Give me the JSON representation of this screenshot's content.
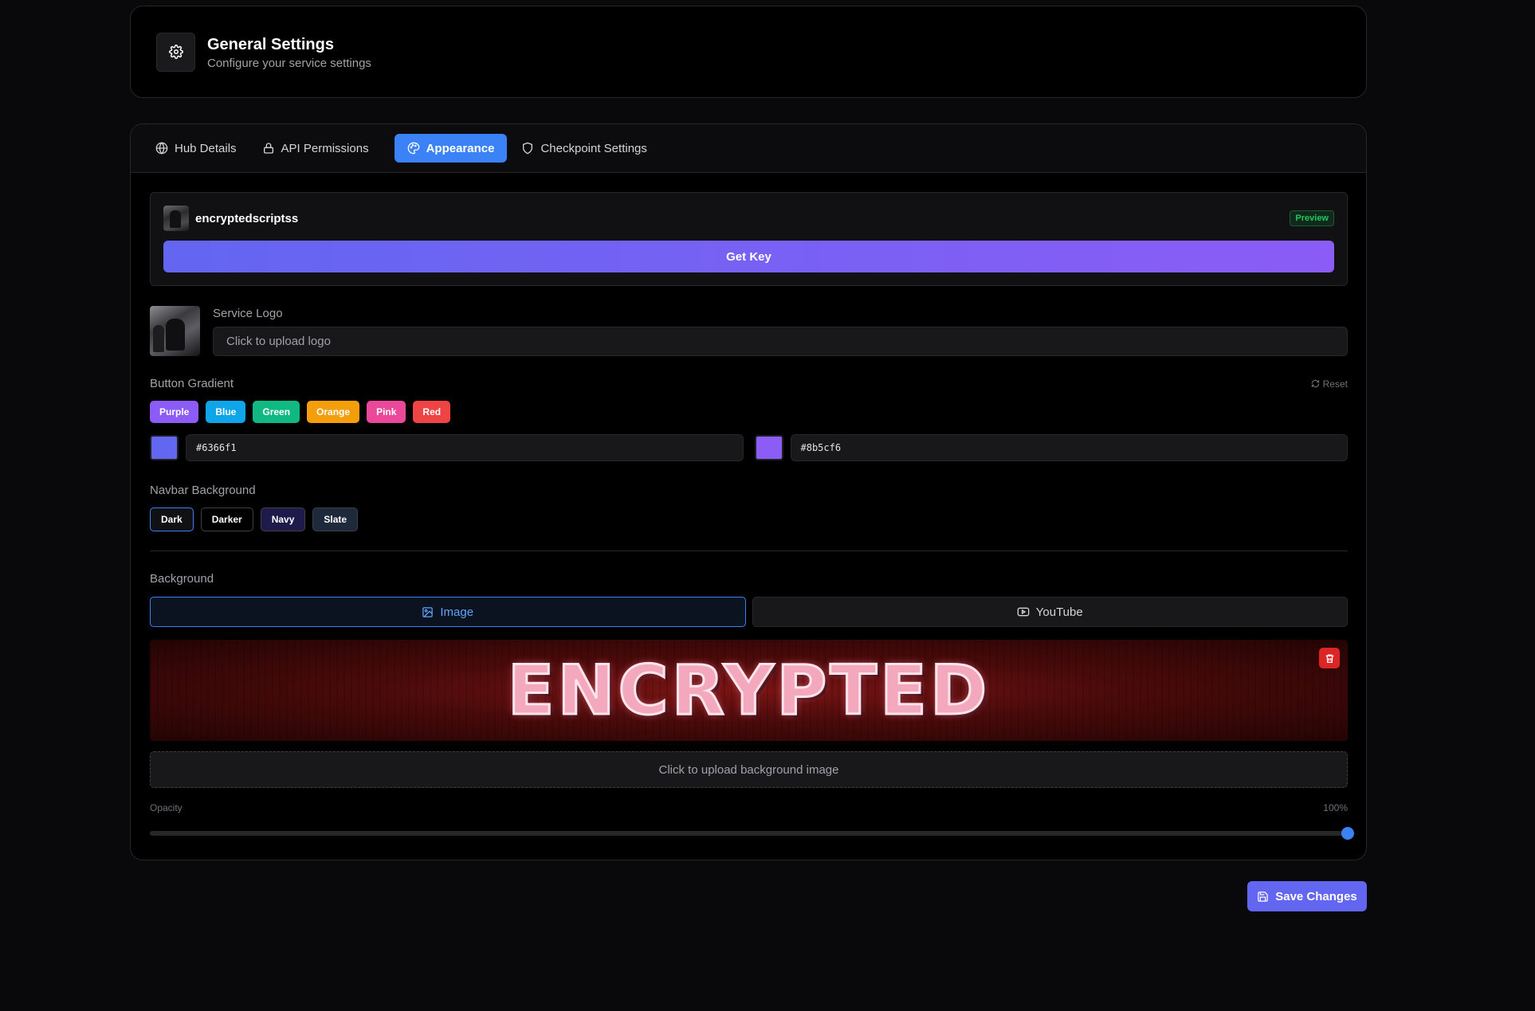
{
  "header": {
    "title": "General Settings",
    "subtitle": "Configure your service settings",
    "icon": "gear-icon"
  },
  "tabs": [
    {
      "label": "Hub Details",
      "icon": "globe-icon",
      "active": false
    },
    {
      "label": "API Permissions",
      "icon": "lock-icon",
      "active": false
    },
    {
      "label": "Appearance",
      "icon": "palette-icon",
      "active": true
    },
    {
      "label": "Checkpoint Settings",
      "icon": "shield-icon",
      "active": false
    }
  ],
  "preview": {
    "name": "encryptedscriptss",
    "badge": "Preview",
    "button_label": "Get Key"
  },
  "logo": {
    "label": "Service Logo",
    "upload_placeholder": "Click to upload logo"
  },
  "gradient": {
    "label": "Button Gradient",
    "reset_label": "Reset",
    "presets": [
      {
        "label": "Purple",
        "color": "#8b5cf6"
      },
      {
        "label": "Blue",
        "color": "#0ea5e9"
      },
      {
        "label": "Green",
        "color": "#10b981"
      },
      {
        "label": "Orange",
        "color": "#f59e0b"
      },
      {
        "label": "Pink",
        "color": "#ec4899"
      },
      {
        "label": "Red",
        "color": "#ef4444"
      }
    ],
    "color_start": "#6366f1",
    "color_end": "#8b5cf6"
  },
  "navbar": {
    "label": "Navbar Background",
    "options": [
      {
        "label": "Dark",
        "color": "#111113",
        "selected": true
      },
      {
        "label": "Darker",
        "color": "#000000",
        "selected": false
      },
      {
        "label": "Navy",
        "color": "#1e1b4b",
        "selected": false
      },
      {
        "label": "Slate",
        "color": "#1e293b",
        "selected": false
      }
    ]
  },
  "background": {
    "label": "Background",
    "image_label": "Image",
    "youtube_label": "YouTube",
    "banner_text": "ENCRYPTED",
    "upload_label": "Click to upload background image",
    "opacity_label": "Opacity",
    "opacity_value": "100%",
    "opacity": 1.0
  },
  "save_label": "Save Changes"
}
